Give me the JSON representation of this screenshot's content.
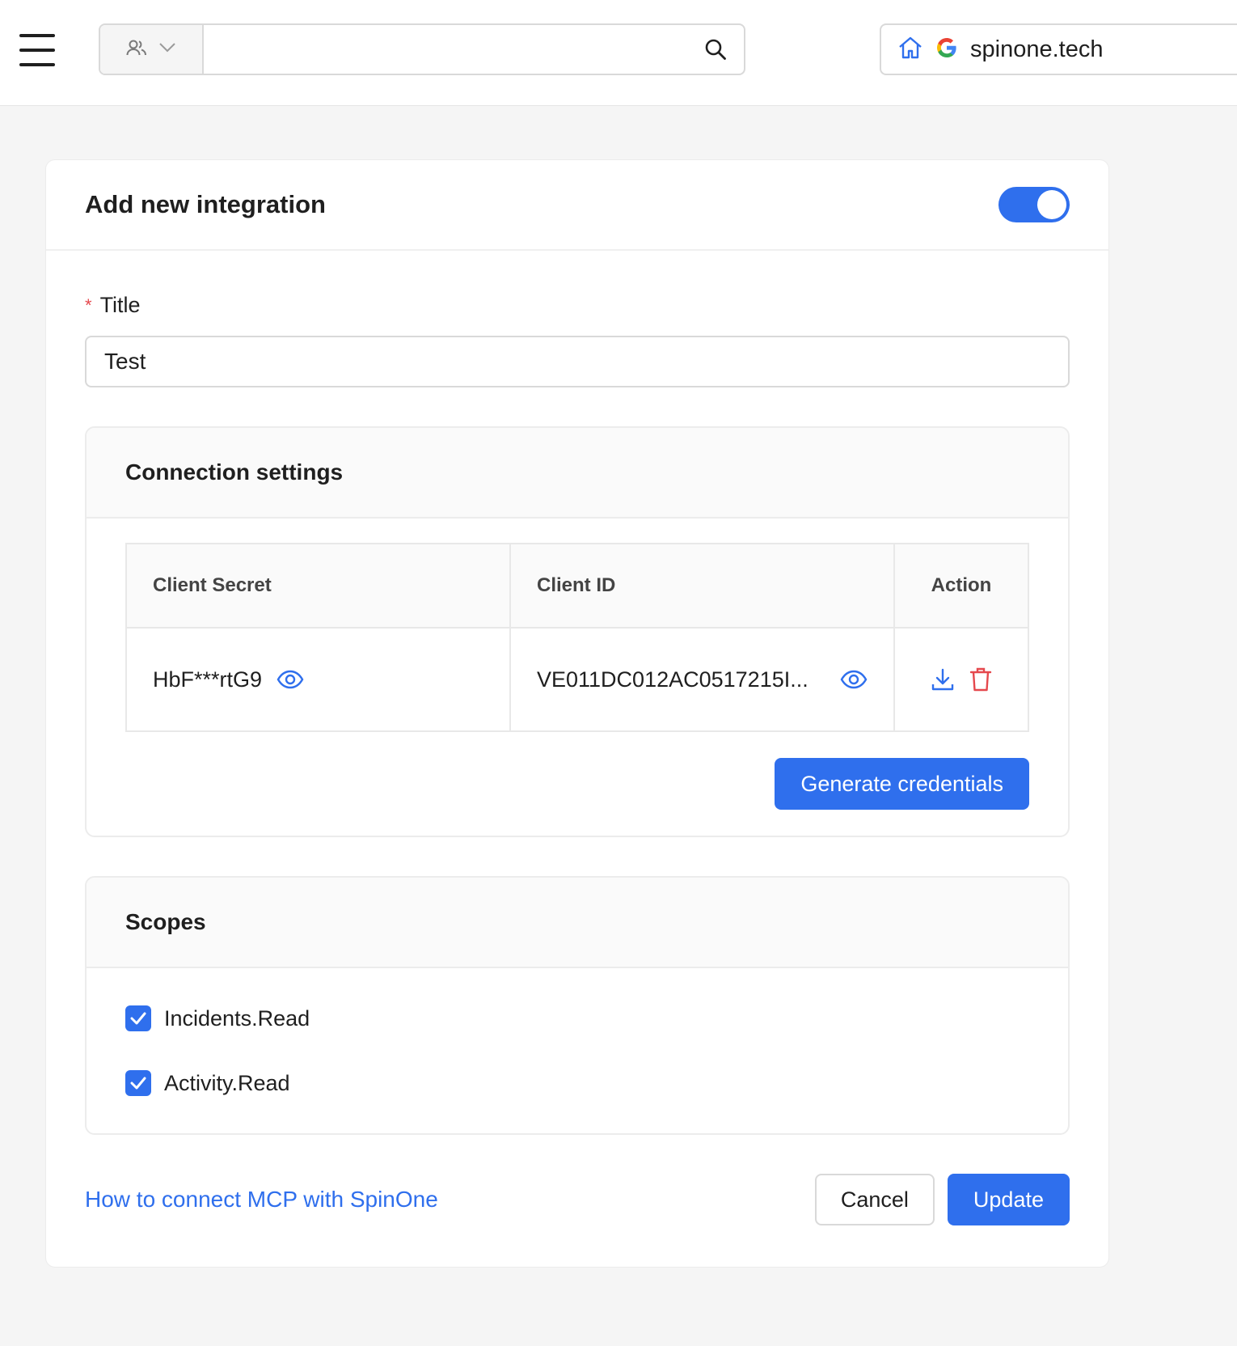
{
  "topbar": {
    "search_placeholder": "",
    "domain": "spinone.tech",
    "google_logo_letter": "G"
  },
  "dialog": {
    "title": "Add new integration",
    "enabled": true
  },
  "form": {
    "title_label": "Title",
    "title_value": "Test"
  },
  "connection": {
    "heading": "Connection settings",
    "columns": [
      "Client Secret",
      "Client ID",
      "Action"
    ],
    "client_secret": "HbF***rtG9",
    "client_id": "VE011DC012AC0517215I...",
    "generate_label": "Generate credentials"
  },
  "scopes": {
    "heading": "Scopes",
    "items": [
      {
        "label": "Incidents.Read",
        "checked": true
      },
      {
        "label": "Activity.Read",
        "checked": true
      }
    ]
  },
  "footer": {
    "help_link": "How to connect MCP with SpinOne",
    "cancel_label": "Cancel",
    "update_label": "Update"
  },
  "colors": {
    "accent": "#2f6fed",
    "danger": "#e5484d",
    "background": "#f5f5f5"
  },
  "icons": [
    "menu-icon",
    "users-icon",
    "chevron-down-icon",
    "search-icon",
    "home-icon",
    "google-icon",
    "eye-icon",
    "download-icon",
    "trash-icon",
    "check-icon"
  ]
}
